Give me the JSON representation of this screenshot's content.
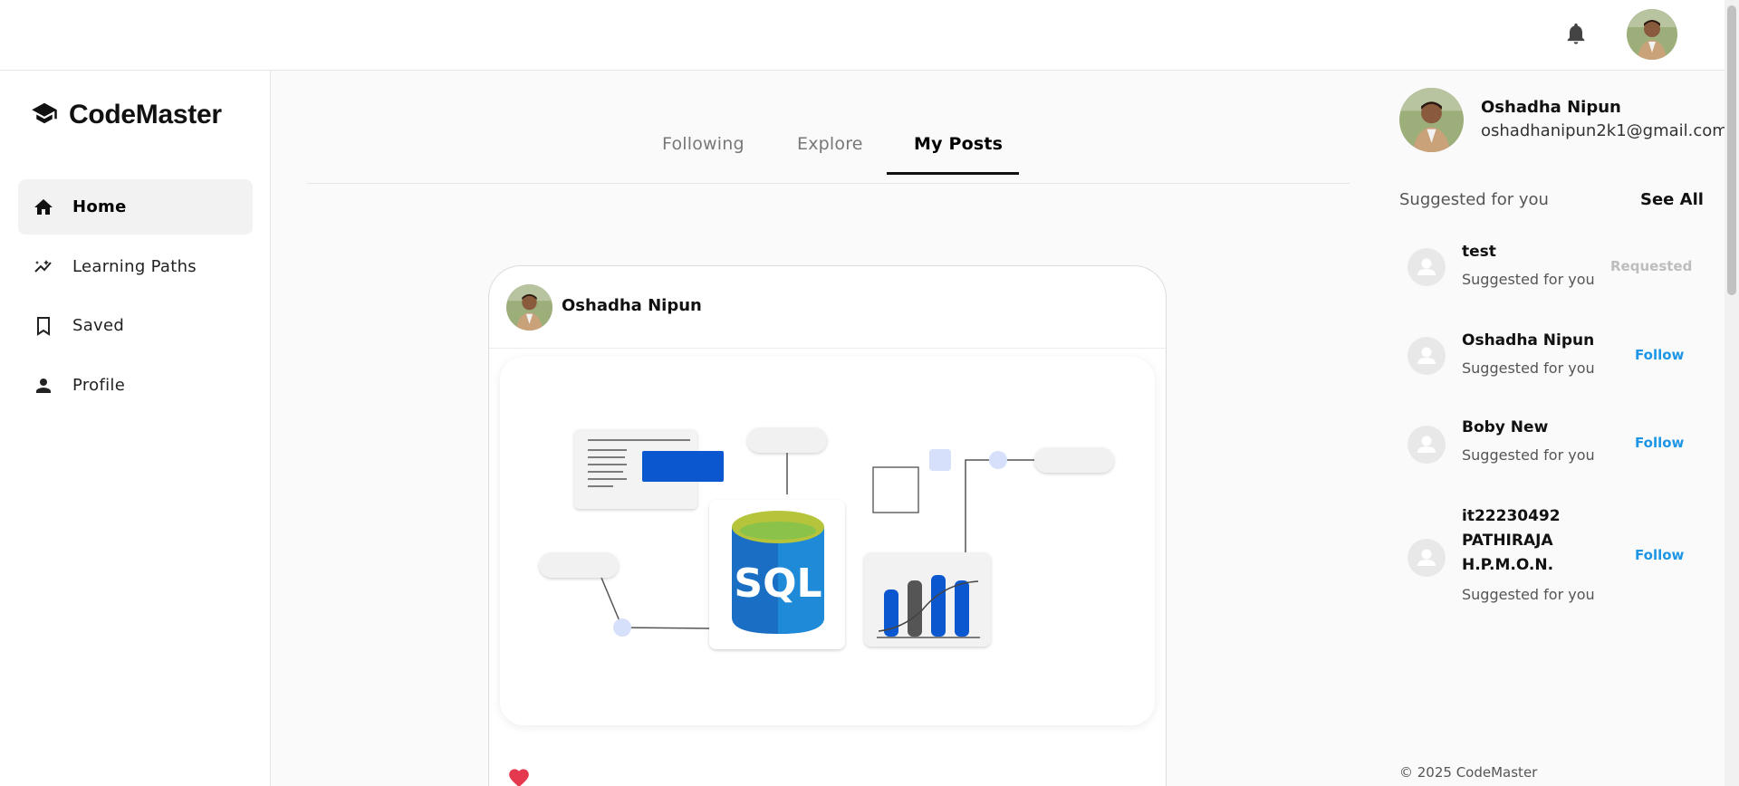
{
  "header": {
    "notifications_icon": "bell-icon"
  },
  "brand": {
    "name": "CodeMaster",
    "icon": "graduation-cap-icon"
  },
  "sidebar": {
    "items": [
      {
        "label": "Home",
        "icon": "home-icon",
        "active": true
      },
      {
        "label": "Learning Paths",
        "icon": "trending-icon",
        "active": false
      },
      {
        "label": "Saved",
        "icon": "bookmark-icon",
        "active": false
      },
      {
        "label": "Profile",
        "icon": "person-icon",
        "active": false
      }
    ]
  },
  "tabs": [
    {
      "label": "Following",
      "active": false
    },
    {
      "label": "Explore",
      "active": false
    },
    {
      "label": "My Posts",
      "active": true
    }
  ],
  "post": {
    "author": "Oshadha Nipun",
    "image": {
      "text": "SQL"
    }
  },
  "profile": {
    "name": "Oshadha Nipun",
    "email": "oshadhanipun2k1@gmail.com"
  },
  "suggestions": {
    "title": "Suggested for you",
    "see_all": "See All",
    "items": [
      {
        "name": "test",
        "subtitle": "Suggested for you",
        "action": "Requested"
      },
      {
        "name": "Oshadha Nipun",
        "subtitle": "Suggested for you",
        "action": "Follow"
      },
      {
        "name": "Boby New",
        "subtitle": "Suggested for you",
        "action": "Follow"
      },
      {
        "name_lines": [
          "it22230492",
          "PATHIRAJA",
          "H.P.M.O.N."
        ],
        "subtitle": "Suggested for you",
        "action": "Follow"
      }
    ]
  },
  "footer": {
    "copyright": "© 2025 CodeMaster"
  },
  "colors": {
    "accent": "#1e96e6",
    "heart": "#e53950",
    "sql_blue": "#1a6fc4"
  }
}
